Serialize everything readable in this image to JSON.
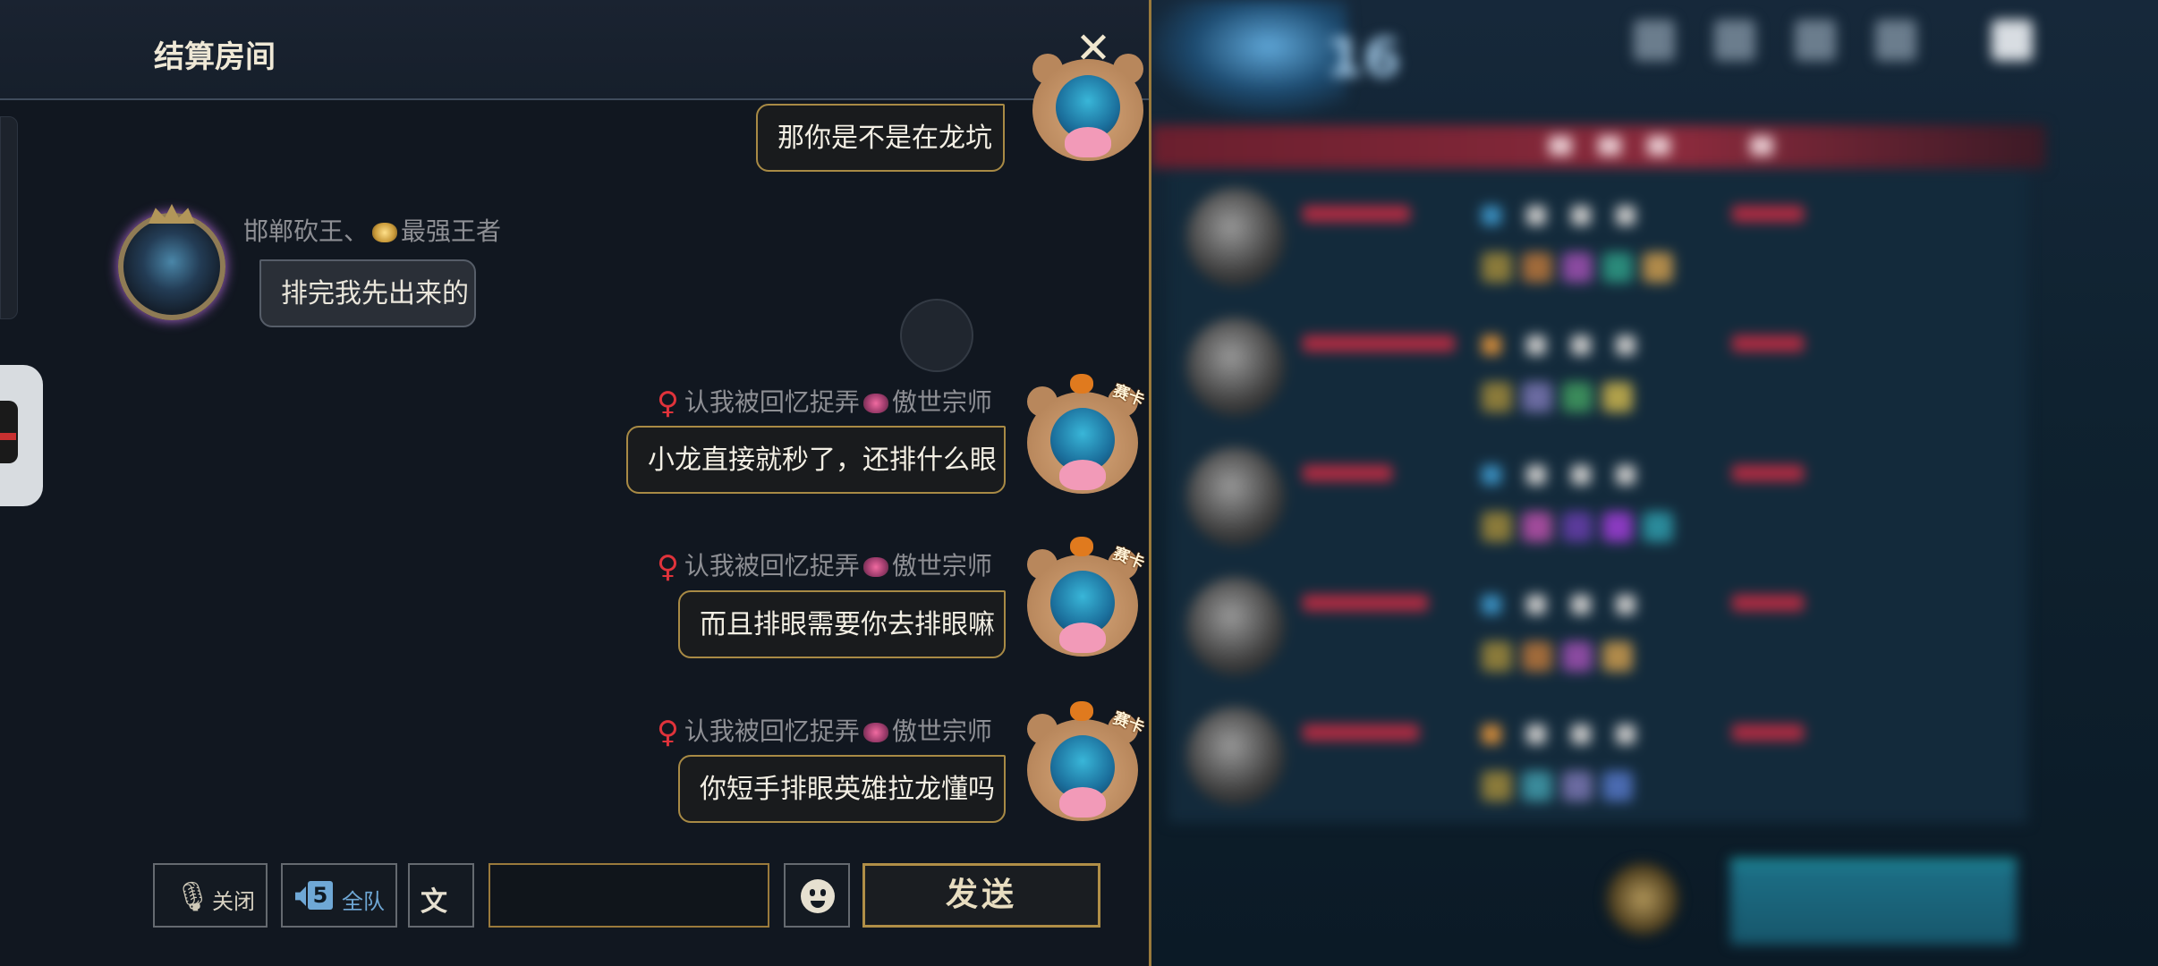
{
  "window": {
    "title": "结算房间"
  },
  "messages": [
    {
      "side": "mine",
      "sender": "",
      "text": "那你是不是在龙坑"
    },
    {
      "side": "theirs",
      "sender": "邯郸砍王、",
      "rank": "最强王者",
      "text": "排完我先出来的"
    },
    {
      "side": "mine",
      "gender": "♀",
      "sender": "认我被回忆捉弄",
      "rank": "傲世宗师",
      "text": "小龙直接就秒了，还排什么眼"
    },
    {
      "side": "mine",
      "gender": "♀",
      "sender": "认我被回忆捉弄",
      "rank": "傲世宗师",
      "text": "而且排眼需要你去排眼嘛"
    },
    {
      "side": "mine",
      "gender": "♀",
      "sender": "认我被回忆捉弄",
      "rank": "傲世宗师",
      "text": "你短手排眼英雄拉龙懂吗"
    }
  ],
  "avatar_tag": "赛卡",
  "toolbar": {
    "mute_label": "关闭",
    "team_number": "5",
    "team_label": "全队",
    "voice_text_icon": "文",
    "input_value": "",
    "input_placeholder": "",
    "send_label": "发送"
  },
  "scoreboard": {
    "level": "16"
  },
  "icons": {
    "close": "close-icon",
    "mute": "mic-off-icon",
    "team": "speaker-icon",
    "voice_text": "voice-to-text-icon",
    "emoji": "emoji-icon"
  },
  "colors": {
    "accent_gold": "#a88a45",
    "gender_red": "#e0333b",
    "team_blue": "#6fa8d6"
  }
}
